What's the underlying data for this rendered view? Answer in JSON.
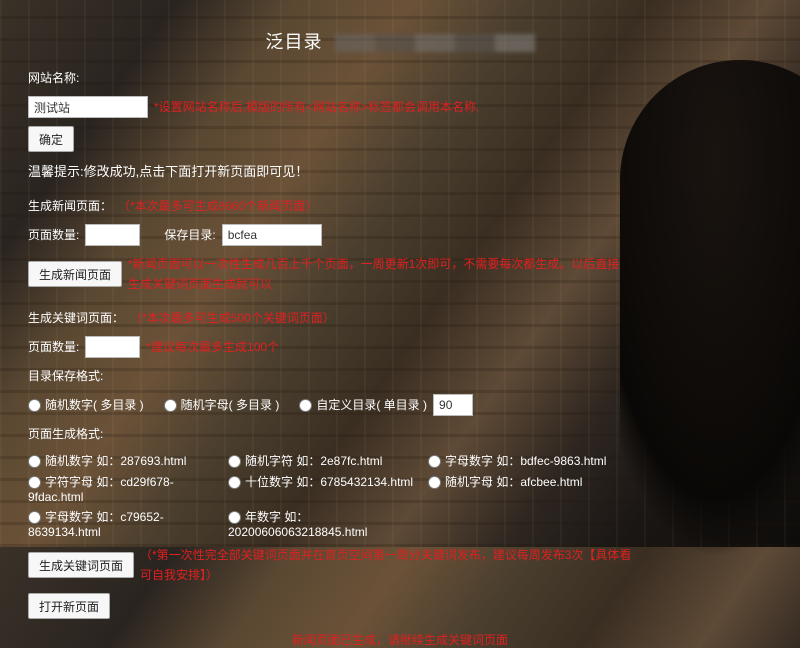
{
  "header": {
    "title_prefix": "泛目录"
  },
  "site": {
    "name_label": "网站名称:",
    "name_value": "测试站",
    "name_hint": "*设置网站名称后,模版的所有<网站名称>标签都会调用本名称.",
    "confirm_btn": "确定"
  },
  "tip": "温馨提示:修改成功,点击下面打开新页面即可见！",
  "news": {
    "heading": "生成新闻页面：",
    "limit_hint": "（*本次最多可生成8660个新闻页面）",
    "count_label": "页面数量:",
    "count_value": "",
    "dir_label": "保存目录:",
    "dir_value": "bcfea",
    "gen_btn": "生成新闻页面",
    "gen_hint": "*新闻页面可以一次性生成几百上千个页面，一周更新1次即可，不需要每次都生成。以后直接执行生成关键词页面生成就可以"
  },
  "kw": {
    "heading": "生成关键词页面：",
    "limit_hint": "（*本次最多可生成500个关键词页面）",
    "count_label": "页面数量:",
    "count_value": "",
    "count_hint": "*建议每次最多生成100个",
    "dirfmt_label": "目录保存格式:",
    "dirfmt_opts": {
      "a": "随机数字( 多目录 )",
      "b": "随机字母( 多目录 )",
      "c": "自定义目录( 单目录 )"
    },
    "dirfmt_custom": "90",
    "pagefmt_label": "页面生成格式:",
    "pagefmt_opts": {
      "a": "随机数字 如：287693.html",
      "b": "随机字符 如：2e87fc.html",
      "c": "字母数字 如：bdfec-9863.html",
      "d": "字符字母 如：cd29f678-9fdac.html",
      "e": "十位数字 如：6785432134.html",
      "f": "随机字母 如：afcbee.html",
      "g": "字母数字 如：c79652-8639134.html",
      "h": "年数字 如：20200606063218845.html"
    },
    "gen_btn": "生成关键词页面",
    "gen_hint": "（*第一次性完全部关键词页面并在首页空间第一周分关键词发布，建议每周发布3次【具体看可自我安排】）",
    "open_btn": "打开新页面"
  },
  "footer": {
    "text": "新闻页面已生成，请继续生成关键词页面"
  }
}
